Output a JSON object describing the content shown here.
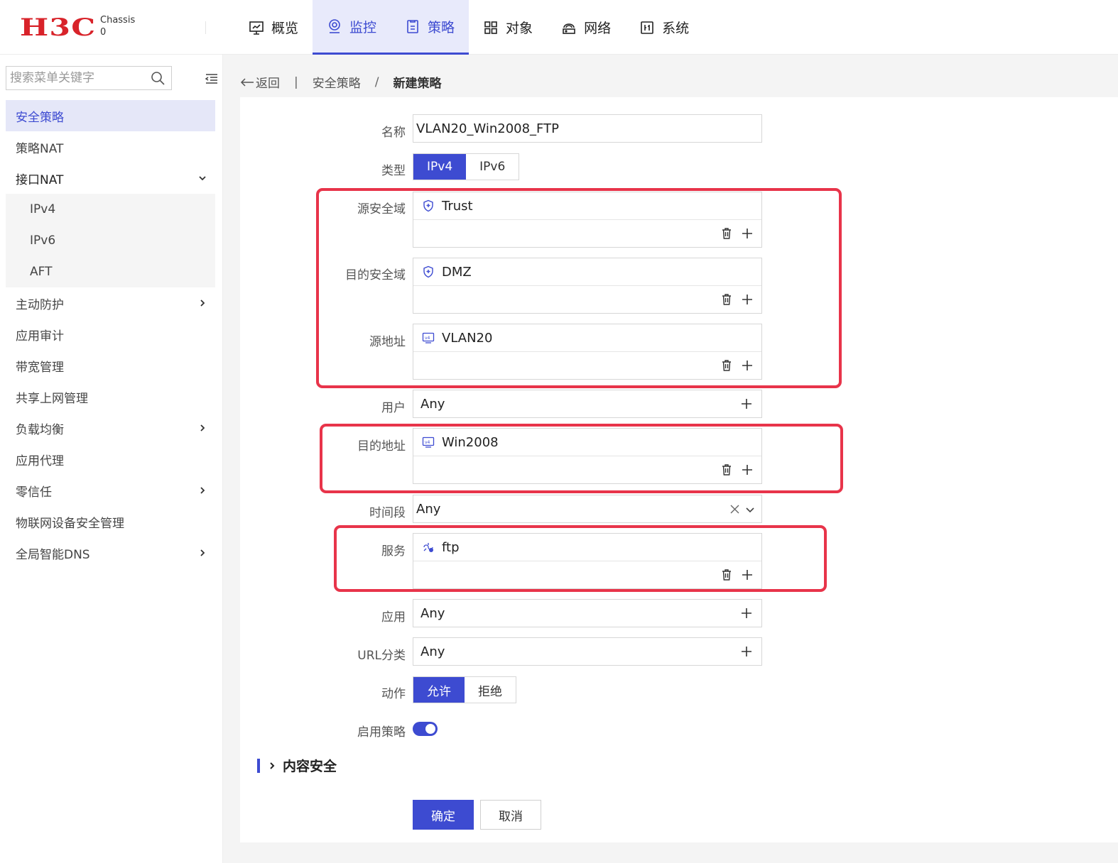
{
  "header": {
    "logo": "H3C",
    "chassis_label": "Chassis",
    "chassis_value": "0",
    "nav": [
      {
        "label": "概览",
        "icon": "monitor-chart-icon"
      },
      {
        "label": "监控",
        "icon": "monitor-eye-icon"
      },
      {
        "label": "策略",
        "icon": "policy-icon"
      },
      {
        "label": "对象",
        "icon": "grid-icon"
      },
      {
        "label": "网络",
        "icon": "network-icon"
      },
      {
        "label": "系统",
        "icon": "system-icon"
      }
    ],
    "active_nav": "监控"
  },
  "sidebar": {
    "search_placeholder": "搜索菜单关键字",
    "items": [
      {
        "label": "安全策略"
      },
      {
        "label": "策略NAT"
      },
      {
        "label": "接口NAT",
        "sub": [
          "IPv4",
          "IPv6",
          "AFT"
        ]
      },
      {
        "label": "主动防护"
      },
      {
        "label": "应用审计"
      },
      {
        "label": "带宽管理"
      },
      {
        "label": "共享上网管理"
      },
      {
        "label": "负载均衡"
      },
      {
        "label": "应用代理"
      },
      {
        "label": "零信任"
      },
      {
        "label": "物联网设备安全管理"
      },
      {
        "label": "全局智能DNS"
      }
    ]
  },
  "breadcrumb": {
    "back": "返回",
    "parent": "安全策略",
    "current": "新建策略"
  },
  "form": {
    "name": {
      "label": "名称",
      "value": "VLAN20_Win2008_FTP"
    },
    "type": {
      "label": "类型",
      "options": [
        "IPv4",
        "IPv6"
      ],
      "selected": "IPv4"
    },
    "src_zone": {
      "label": "源安全域",
      "value": "Trust"
    },
    "dst_zone": {
      "label": "目的安全域",
      "value": "DMZ"
    },
    "src_addr": {
      "label": "源地址",
      "value": "VLAN20"
    },
    "user": {
      "label": "用户",
      "value": "Any"
    },
    "dst_addr": {
      "label": "目的地址",
      "value": "Win2008"
    },
    "time": {
      "label": "时间段",
      "value": "Any"
    },
    "service": {
      "label": "服务",
      "value": "ftp"
    },
    "app": {
      "label": "应用",
      "value": "Any"
    },
    "url": {
      "label": "URL分类",
      "value": "Any"
    },
    "action": {
      "label": "动作",
      "options": [
        "允许",
        "拒绝"
      ],
      "selected": "允许"
    },
    "enable": {
      "label": "启用策略",
      "on": true
    },
    "content_security": "内容安全",
    "ok": "确定",
    "cancel": "取消"
  },
  "colors": {
    "accent": "#3d4bd1",
    "highlight": "#e8344a",
    "brand": "#d8232a"
  }
}
